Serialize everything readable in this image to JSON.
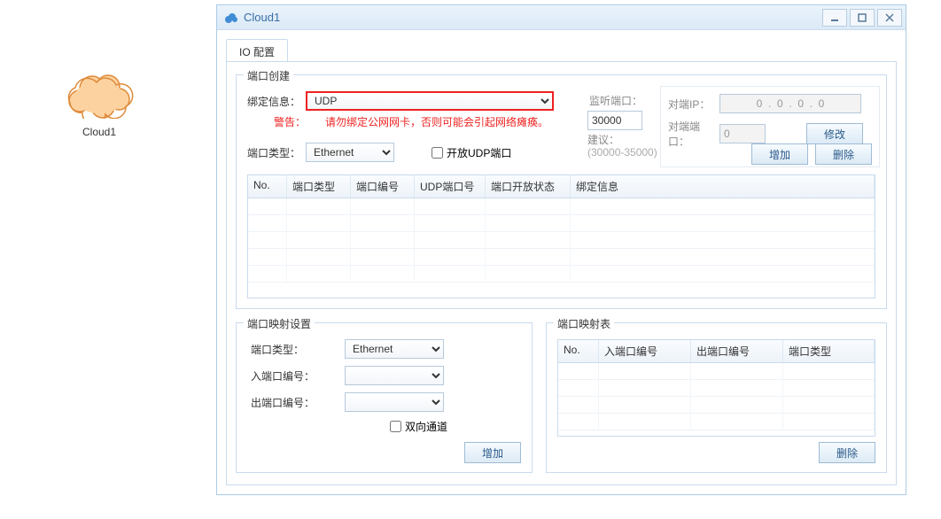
{
  "cloud_node_label": "Cloud1",
  "window": {
    "title": "Cloud1",
    "tab_label": "IO 配置",
    "group_port_create": {
      "legend": "端口创建",
      "bind_info_label": "绑定信息：",
      "bind_info_value": "UDP",
      "warning_label": "警告：",
      "warning_text": "请勿绑定公网网卡，否则可能会引起网络瘫痪。",
      "port_type_label": "端口类型：",
      "port_type_value": "Ethernet",
      "open_udp_label": "开放UDP端口",
      "open_udp_checked": false,
      "listen_port_label": "监听端口：",
      "listen_port_value": "30000",
      "suggestion_label": "建议：",
      "suggestion_range": "(30000-35000)",
      "peer_ip_label": "对端IP：",
      "peer_ip_value": "0  .  0  .  0  .  0",
      "peer_port_label": "对端端口：",
      "peer_port_value": "0",
      "modify_button": "修改",
      "add_button": "增加",
      "delete_button": "删除",
      "table": {
        "headers": [
          "No.",
          "端口类型",
          "端口编号",
          "UDP端口号",
          "端口开放状态",
          "绑定信息"
        ],
        "rows": []
      }
    },
    "group_port_map_setting": {
      "legend": "端口映射设置",
      "port_type_label": "端口类型：",
      "port_type_value": "Ethernet",
      "in_port_idx_label": "入端口编号：",
      "in_port_idx_value": "",
      "out_port_idx_label": "出端口编号：",
      "out_port_idx_value": "",
      "bidir_label": "双向通道",
      "bidir_checked": false,
      "add_button": "增加"
    },
    "group_port_map_table": {
      "legend": "端口映射表",
      "headers": [
        "No.",
        "入端口编号",
        "出端口编号",
        "端口类型"
      ],
      "rows": [],
      "delete_button": "删除"
    }
  }
}
